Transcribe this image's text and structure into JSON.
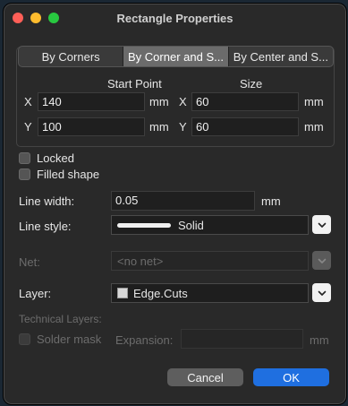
{
  "window": {
    "title": "Rectangle Properties"
  },
  "tabs": [
    {
      "label": "By Corners"
    },
    {
      "label": "By Corner and S..."
    },
    {
      "label": "By Center and S..."
    }
  ],
  "geometry": {
    "start_point_header": "Start Point",
    "size_header": "Size",
    "start": {
      "x_label": "X",
      "x_value": "140",
      "y_label": "Y",
      "y_value": "100",
      "unit": "mm"
    },
    "size": {
      "x_label": "X",
      "x_value": "60",
      "y_label": "Y",
      "y_value": "60",
      "unit": "mm"
    }
  },
  "options": {
    "locked_label": "Locked",
    "filled_label": "Filled shape"
  },
  "line_width": {
    "label": "Line width:",
    "value": "0.05",
    "unit": "mm"
  },
  "line_style": {
    "label": "Line style:",
    "value": "Solid"
  },
  "net": {
    "label": "Net:",
    "placeholder": "<no net>"
  },
  "layer": {
    "label": "Layer:",
    "value": "Edge.Cuts"
  },
  "technical": {
    "header": "Technical Layers:",
    "solder_mask_label": "Solder mask",
    "expansion_label": "Expansion:",
    "unit": "mm"
  },
  "buttons": {
    "cancel": "Cancel",
    "ok": "OK"
  },
  "colors": {
    "ok_button": "#1f6fe0",
    "close": "#ff5f57",
    "minimize": "#febc2e",
    "maximize": "#28c840"
  }
}
